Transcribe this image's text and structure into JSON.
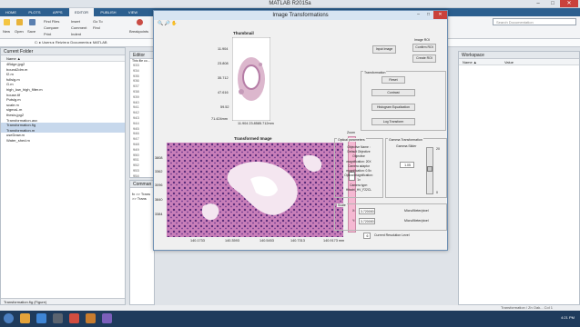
{
  "window": {
    "title": "MATLAB R2015a"
  },
  "tabs": [
    "HOME",
    "PLOTS",
    "APPS",
    "EDITOR",
    "PUBLISH",
    "VIEW"
  ],
  "ribbon": {
    "new": "New",
    "open": "Open",
    "save": "Save",
    "find_files": "Find Files",
    "compare": "Compare",
    "print": "Print",
    "insert": "Insert",
    "comment": "Comment",
    "indent": "Indent",
    "go_to": "Go To",
    "find": "Find",
    "breakpoints": "Breakpoints"
  },
  "search": {
    "placeholder": "Search Documentation"
  },
  "address": {
    "path": "C: ▸ Users ▸ Reizim ▸ Documents ▸ MATLAB"
  },
  "current_folder": {
    "title": "Current Folder",
    "column": "Name ▲",
    "files": [
      "4Bdge.jpg2",
      "bound2dm.m",
      "f2.m",
      "fullsig.m",
      "G.m",
      "high_low_high_filter.m",
      "house.tif",
      "Putsig.m",
      "scale.m",
      "sigmaL.m",
      "thesis.jpg2",
      "Transformation.asv",
      "Transformation.fig",
      "Transformation.m",
      "useDraw.m",
      "Water_shed.m"
    ],
    "selected": [
      12,
      13
    ],
    "details": "Transformation.fig (Figure)"
  },
  "editor": {
    "title": "Editor",
    "tab": "This file co...",
    "line_numbers": [
      "933",
      "934",
      "935",
      "936",
      "937",
      "938",
      "939",
      "940",
      "941",
      "942",
      "943",
      "944",
      "945",
      "946",
      "947",
      "948",
      "949",
      "950",
      "951",
      "952",
      "953",
      "954",
      "955",
      "956"
    ]
  },
  "command_window": {
    "title": "Comman",
    "lines": [
      "fx >> Trans",
      "   >> Trans"
    ]
  },
  "workspace": {
    "title": "Workspace",
    "columns": [
      "Name ▲",
      "Value"
    ]
  },
  "dialog": {
    "title": "Image Transformations",
    "toolbar": "🔍 🔎 ✋",
    "thumbnail": {
      "title": "Thumbnail",
      "y_ticks": [
        "11.904",
        "23.808",
        "35.712",
        "47.616",
        "59.52",
        "71.424mm"
      ],
      "x_ticks": "11.904 23.8585.712mm"
    },
    "transformed": {
      "title": "Transformed Image",
      "y_ticks": [
        "3808",
        "3362",
        "3096",
        "3840",
        "3384"
      ],
      "x_ticks": [
        "140.1733",
        "140.3593",
        "140.5453",
        "140.7313",
        "140.9173 mm"
      ]
    },
    "zoom_label": "Zoom",
    "input_image_btn": "Input Image",
    "image_roi": {
      "label": "Image ROI",
      "confirm": "Confirm ROI",
      "create": "Create ROI"
    },
    "transformation": {
      "label": "Transformation",
      "buttons": [
        "Reset",
        "Contrast",
        "Histogram Equalization",
        "Log Transform"
      ]
    },
    "optical": {
      "label": "Optical parameters",
      "lines": [
        "Objective Name :",
        "Default Objective",
        "Objective",
        "magnification: 20X",
        "Camera adaptor",
        "magnification: 0.5x",
        "Optical magnification:",
        "1x",
        "Camera type:",
        "Hitachi_HV_F22CL"
      ]
    },
    "gamma": {
      "label": "Gamma Transformation",
      "slider_label": "Gamma Slider",
      "top_value": "20",
      "value": "1.05",
      "bottom_value": "0"
    },
    "scale": {
      "label": "Scale",
      "x_label": "X:",
      "x_value": "3.720000",
      "x_unit": "Micro/Meter/pixel",
      "y_label": "Y:",
      "y_value": "3.720000",
      "y_unit": "Micro/Meter/pixel"
    },
    "resolution": {
      "value": "6",
      "label": "Current Resolution Level"
    }
  },
  "status_right": "Transformation / Zn  Oak...  Col 1",
  "taskbar": {
    "time": "4:21 PM"
  }
}
